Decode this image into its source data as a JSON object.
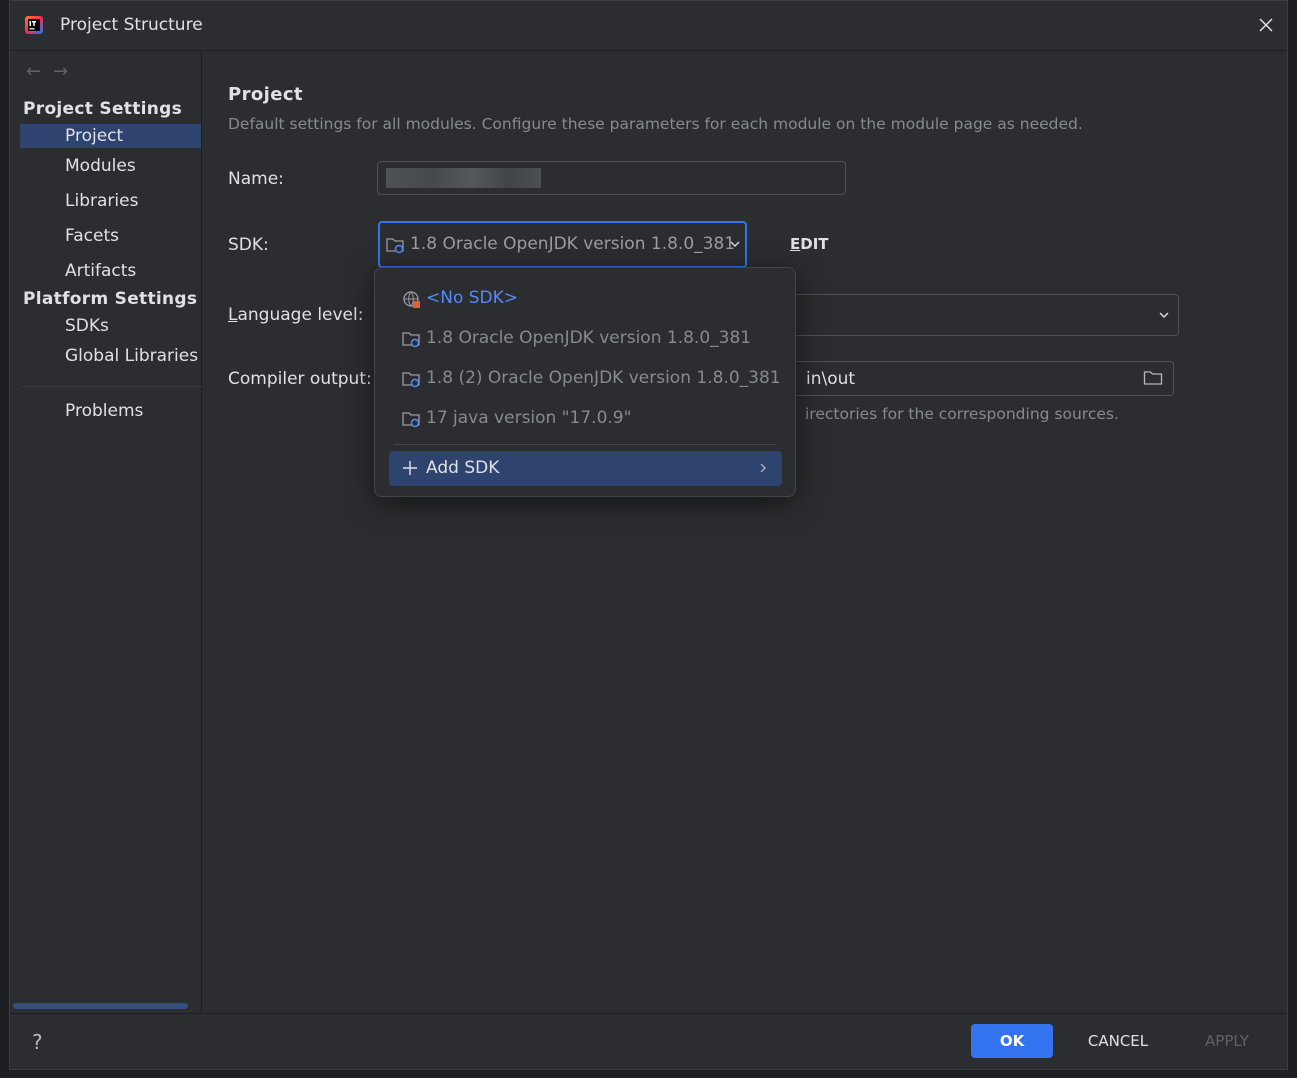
{
  "window": {
    "title": "Project Structure"
  },
  "sidebar": {
    "nav_back_icon": "arrow-left-icon",
    "nav_forward_icon": "arrow-right-icon",
    "project_settings_header": "Project Settings",
    "project_settings_items": [
      {
        "label": "Project",
        "selected": true
      },
      {
        "label": "Modules"
      },
      {
        "label": "Libraries"
      },
      {
        "label": "Facets"
      },
      {
        "label": "Artifacts"
      }
    ],
    "platform_settings_header": "Platform Settings",
    "platform_settings_items": [
      {
        "label": "SDKs"
      },
      {
        "label": "Global Libraries"
      }
    ],
    "problems_label": "Problems"
  },
  "main": {
    "title": "Project",
    "description": "Default settings for all modules. Configure these parameters for each module on the module page as needed.",
    "name_label": "Name:",
    "name_value": "",
    "sdk_label": "SDK:",
    "sdk_selected": "1.8 Oracle OpenJDK version 1.8.0_381",
    "edit_label": "EDIT",
    "language_level_label_u": "L",
    "language_level_label_rest": "anguage level:",
    "compiler_output_label": "Compiler output:",
    "compiler_output_visible": "in\\out",
    "compiler_output_hint_visible": "irectories for the corresponding sources."
  },
  "sdk_popup": {
    "options": [
      {
        "label": "<No SDK>",
        "icon": "globe-warning-icon"
      },
      {
        "label": "1.8 Oracle OpenJDK version 1.8.0_381",
        "icon": "jdk-folder-icon"
      },
      {
        "label": "1.8 (2) Oracle OpenJDK version 1.8.0_381",
        "icon": "jdk-folder-icon"
      },
      {
        "label": "17 java version \"17.0.9\"",
        "icon": "jdk-folder-icon"
      }
    ],
    "add_sdk_label": "Add SDK"
  },
  "footer": {
    "help_label": "?",
    "ok_label": "OK",
    "cancel_label": "CANCEL",
    "apply_label": "APPLY"
  },
  "colors": {
    "accent": "#3574f0",
    "selection": "#2e436e",
    "no_sdk_link": "#548af7",
    "background": "#2b2d30"
  }
}
